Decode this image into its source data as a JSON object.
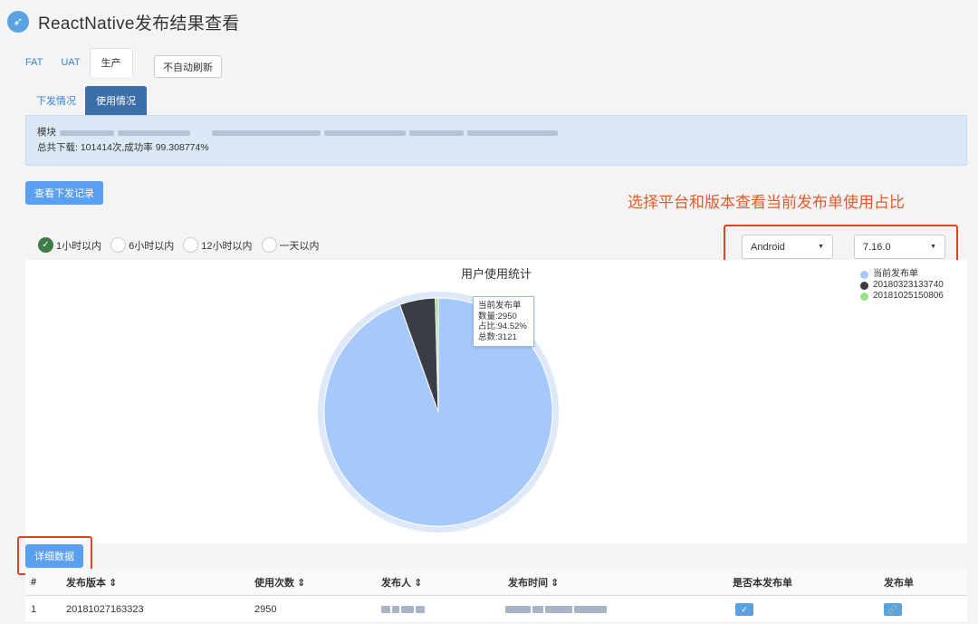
{
  "app": {
    "title": "ReactNative发布结果查看",
    "logo_icon": "rocket-icon"
  },
  "env_tabs": [
    {
      "label": "FAT",
      "active": false
    },
    {
      "label": "UAT",
      "active": false
    },
    {
      "label": "生产",
      "active": true
    }
  ],
  "refresh_button": "不自动刷新",
  "sub_tabs": [
    {
      "label": "下发情况",
      "active": false
    },
    {
      "label": "使用情况",
      "active": true
    }
  ],
  "info": {
    "module_prefix": "模块",
    "download_summary": "总共下载: 101414次,成功率 99.308774%"
  },
  "record_button": "查看下发记录",
  "annotation": "选择平台和版本查看当前发布单使用占比",
  "time_filters": [
    {
      "label": "1小时以内",
      "checked": true
    },
    {
      "label": "6小时以内",
      "checked": false
    },
    {
      "label": "12小时以内",
      "checked": false
    },
    {
      "label": "一天以内",
      "checked": false
    }
  ],
  "platform_select": {
    "value": "Android"
  },
  "version_select": {
    "value": "7.16.0"
  },
  "chart_data": {
    "type": "pie",
    "title": "用户使用统计",
    "series": [
      {
        "name": "当前发布单",
        "value": 2950,
        "color": "#a6c8fb"
      },
      {
        "name": "20180323133740",
        "value": 158,
        "color": "#3a3d44"
      },
      {
        "name": "20181025150806",
        "value": 13,
        "color": "#9ee08a"
      }
    ],
    "legend_position": "top-right",
    "tooltip": {
      "title": "当前发布单",
      "count": "数量:2950",
      "ratio": "占比:94.52%",
      "total": "总数:3121"
    }
  },
  "detail_button": "详细数据",
  "table": {
    "headers": [
      "#",
      "发布版本 ⇕",
      "使用次数 ⇕",
      "发布人 ⇕",
      "发布时间 ⇕",
      "是否本发布单",
      "发布单"
    ],
    "rows": [
      {
        "index": "1",
        "version": "20181027163323",
        "count": "2950",
        "is_current": true
      }
    ]
  }
}
